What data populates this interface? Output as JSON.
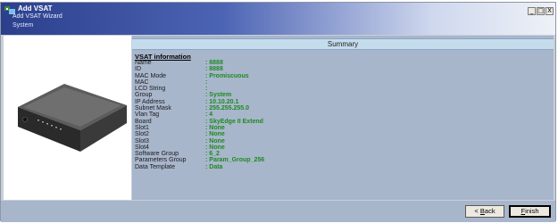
{
  "window": {
    "title": "Add VSAT",
    "subtitle": "Add VSAT Wizard",
    "breadcrumb": "System",
    "controls": {
      "minimize": "_",
      "maximize": "□",
      "close": "X"
    }
  },
  "summary": {
    "header": "Summary",
    "section_title": "VSAT information",
    "rows": [
      {
        "label": "Name",
        "value": ": 8888"
      },
      {
        "label": "ID",
        "value": ": 8888"
      },
      {
        "label": "MAC Mode",
        "value": ": Promiscuous"
      },
      {
        "label": "MAC",
        "value": ":"
      },
      {
        "label": "LCD String",
        "value": ":"
      },
      {
        "label": "Group",
        "value": ": System"
      },
      {
        "label": "IP Address",
        "value": ": 10.10.20.1"
      },
      {
        "label": "Subnet Mask",
        "value": ": 255.255.255.0"
      },
      {
        "label": "Vlan Tag",
        "value": ": 4"
      },
      {
        "label": "Board",
        "value": ": SkyEdge II  Extend"
      },
      {
        "label": "Slot1",
        "value": ": None"
      },
      {
        "label": "Slot2",
        "value": ": None"
      },
      {
        "label": "Slot3",
        "value": ": None"
      },
      {
        "label": "Slot4",
        "value": ": None"
      },
      {
        "label": "Software Group",
        "value": ": 6_2"
      },
      {
        "label": "Parameters Group",
        "value": ": Param_Group_256"
      },
      {
        "label": "Data Template",
        "value": ": Data"
      }
    ]
  },
  "buttons": {
    "back_accel": "B",
    "back_rest": "ack",
    "back_prefix": "< ",
    "finish_accel": "F",
    "finish_rest": "inish"
  },
  "colors": {
    "value_green": "#1d8a1d",
    "header_bg": "#c5dcec",
    "panel_bg": "#a8b6cc"
  },
  "icons": {
    "app": "vsat-app-icon",
    "device": "vsat-modem-image"
  }
}
